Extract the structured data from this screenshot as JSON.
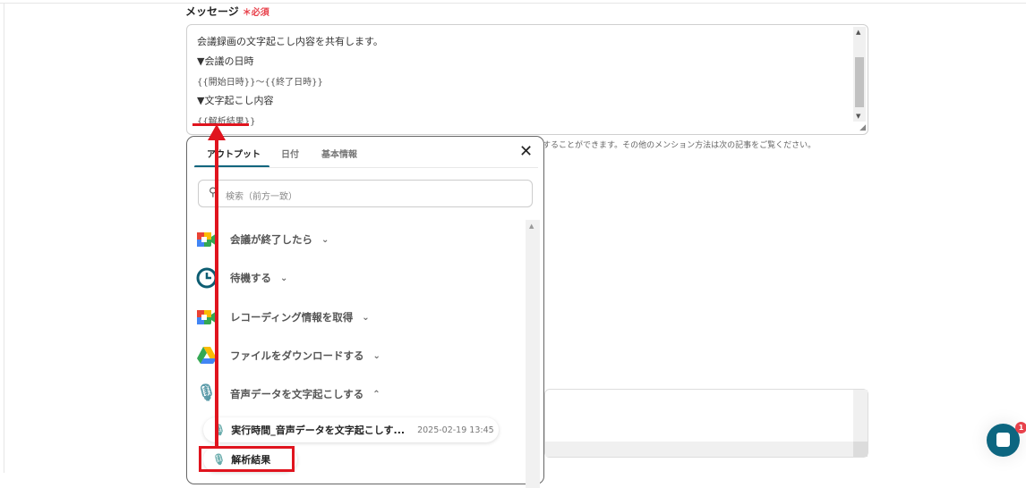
{
  "field": {
    "label": "メッセージ",
    "required": "＊必須"
  },
  "message_lines": [
    "会議録画の文字起こし内容を共有します。",
    "▼会議の日時",
    "{{開始日時}}〜{{終了日時}}",
    "▼文字起こし内容",
    "{{解析結果}}"
  ],
  "hint": "することができます。その他のメンション方法は次の記事をご覧ください。",
  "popup": {
    "tabs": [
      {
        "label": "アウトプット",
        "active": true
      },
      {
        "label": "日付"
      },
      {
        "label": "基本情報"
      }
    ],
    "search_placeholder": "検索（前方一致）",
    "items": [
      {
        "label": "会議が終了したら",
        "icon": "google-meet-icon"
      },
      {
        "label": "待機する",
        "icon": "clock-icon"
      },
      {
        "label": "レコーディング情報を取得",
        "icon": "google-meet-icon"
      },
      {
        "label": "ファイルをダウンロードする",
        "icon": "google-drive-icon"
      },
      {
        "label": "音声データを文字起こしする",
        "icon": "microphone-icon",
        "expanded": true
      }
    ],
    "sub_items": [
      {
        "label": "実行時間_音声データを文字起こしす...",
        "date": "2025-02-19 13:45"
      },
      {
        "label": "解析結果"
      }
    ]
  },
  "chat": {
    "badge": "1"
  },
  "colors": {
    "accent": "#12667e",
    "annotation": "#e0141e"
  }
}
